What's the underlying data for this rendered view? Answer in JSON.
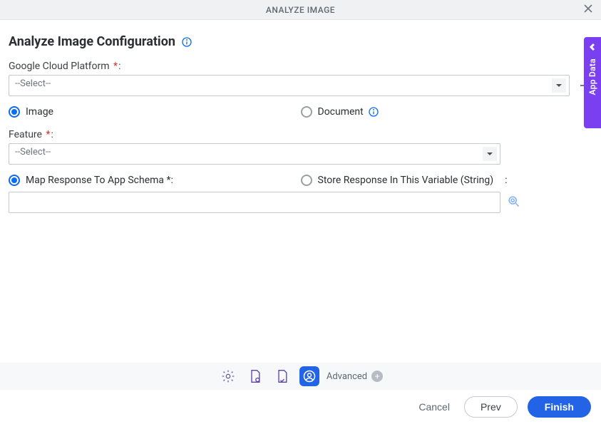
{
  "header": {
    "title": "ANALYZE IMAGE"
  },
  "page": {
    "title": "Analyze Image Configuration"
  },
  "gcp": {
    "label": "Google Cloud Platform",
    "required_mark": "*",
    "colon": ":",
    "select_placeholder": "--Select--"
  },
  "input_type": {
    "image_label": "Image",
    "document_label": "Document"
  },
  "feature": {
    "label": "Feature",
    "required_mark": "*",
    "colon": ":",
    "select_placeholder": "--Select--"
  },
  "response": {
    "map_label": "Map Response To App Schema",
    "map_required": "*",
    "store_label": "Store Response In This Variable (String)",
    "store_colon": ":",
    "colon": ":"
  },
  "toolbar": {
    "advanced_label": "Advanced",
    "advanced_plus": "+"
  },
  "footer": {
    "cancel": "Cancel",
    "prev": "Prev",
    "finish": "Finish"
  },
  "side": {
    "label": "App Data"
  }
}
